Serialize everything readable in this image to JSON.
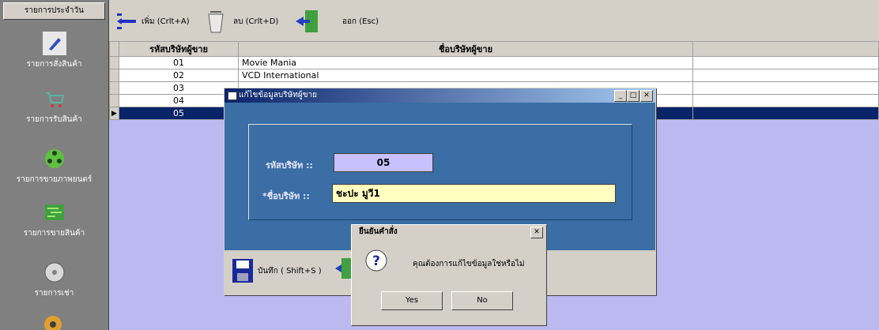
{
  "sidebar": {
    "header": "รายการประจำวัน",
    "items": [
      {
        "label": "รายการสั่งสินค้า",
        "icon": "pencil-icon"
      },
      {
        "label": "รายการรับสินค้า",
        "icon": "cart-icon"
      },
      {
        "label": "รายการขายภาพยนตร์",
        "icon": "film-reel-icon"
      },
      {
        "label": "รายการขายสินค้า",
        "icon": "circuit-board-icon"
      },
      {
        "label": "รายการเช่า",
        "icon": "disc-icon"
      }
    ]
  },
  "toolbar": {
    "add_label": "เพิ่ม (Crlt+A)",
    "delete_label": "ลบ (Crlt+D)",
    "exit_label": "ออก (Esc)"
  },
  "grid": {
    "columns": [
      "รหัสบริษัทผู้ขาย",
      "ชื่อบริษัทผู้ขาย",
      ""
    ],
    "rows": [
      {
        "code": "01",
        "name": "Movie Mania"
      },
      {
        "code": "02",
        "name": "VCD International"
      },
      {
        "code": "03",
        "name": ""
      },
      {
        "code": "04",
        "name": ""
      },
      {
        "code": "05",
        "name": ""
      }
    ],
    "selected_row": "05"
  },
  "edit_dialog": {
    "title": "แก้ไขข้อมูลบริษัทผู้ขาย",
    "code_label": "รหัสบริษัท ::",
    "code_value": "05",
    "name_label": "*ชื่อบริษัท ::",
    "name_value": "ชะปะ มูวี1",
    "save_label": "บันทึก ( Shift+S )"
  },
  "confirm_dialog": {
    "title": "ยืนยันคำสั่ง",
    "message": "คุณต้องการแก้ไขข้อมูลใช่หรือไม่",
    "yes_label": "Yes",
    "no_label": "No"
  },
  "colors": {
    "workspace": "#bcb8f0",
    "dialog_body": "#3a6ea5",
    "selected_row": "#0a246a",
    "name_field": "#ffffc0",
    "code_field": "#c8c0ff"
  }
}
